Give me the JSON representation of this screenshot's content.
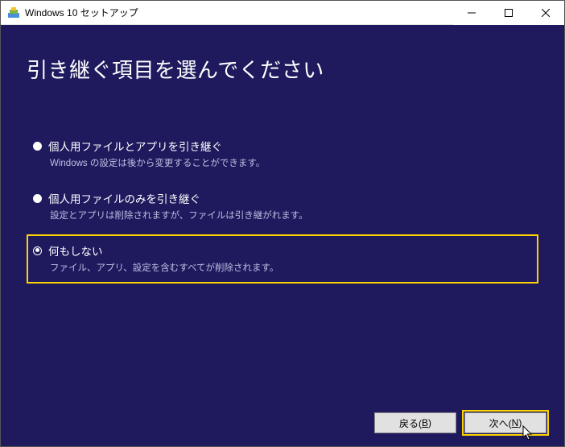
{
  "window": {
    "title": "Windows 10 セットアップ"
  },
  "heading": "引き継ぐ項目を選んでください",
  "options": [
    {
      "label": "個人用ファイルとアプリを引き継ぐ",
      "desc": "Windows の設定は後から変更することができます。",
      "selected": false
    },
    {
      "label": "個人用ファイルのみを引き継ぐ",
      "desc": "設定とアプリは削除されますが、ファイルは引き継がれます。",
      "selected": false
    },
    {
      "label": "何もしない",
      "desc": "ファイル、アプリ、設定を含むすべてが削除されます。",
      "selected": true
    }
  ],
  "buttons": {
    "back_prefix": "戻る(",
    "back_key": "B",
    "back_suffix": ")",
    "next_prefix": "次へ(",
    "next_key": "N",
    "next_suffix": ")"
  }
}
